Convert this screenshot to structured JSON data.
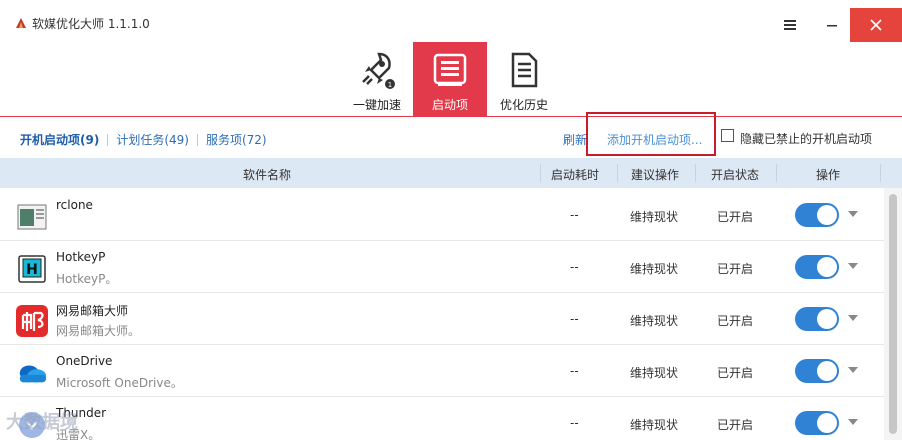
{
  "app": {
    "title": "软媒优化大师 1.1.1.0"
  },
  "window": {
    "menu_icon": "hamburger-icon",
    "min_icon": "minimize-icon",
    "close_icon": "close-icon"
  },
  "nav": [
    {
      "label": "一键加速",
      "icon": "rocket-icon",
      "active": false
    },
    {
      "label": "启动项",
      "icon": "startup-list-icon",
      "active": true
    },
    {
      "label": "优化历史",
      "icon": "document-icon",
      "active": false
    }
  ],
  "subtabs": [
    {
      "label": "开机启动项(9)",
      "active": true
    },
    {
      "label": "计划任务(49)",
      "active": false
    },
    {
      "label": "服务项(72)",
      "active": false
    }
  ],
  "actions": {
    "refresh": "刷新",
    "add_startup": "添加开机启动项...",
    "hide_disabled": "隐藏已禁止的开机启动项"
  },
  "columns": {
    "name": "软件名称",
    "time": "启动耗时",
    "advice": "建议操作",
    "state": "开启状态",
    "action": "操作"
  },
  "rows": [
    {
      "name": "rclone",
      "desc": "",
      "time": "--",
      "advice": "维持现状",
      "state": "已开启",
      "enabled": true,
      "icon": "rclone-app-icon"
    },
    {
      "name": "HotkeyP",
      "desc": "HotkeyP。",
      "time": "--",
      "advice": "维持现状",
      "state": "已开启",
      "enabled": true,
      "icon": "hotkeyp-app-icon"
    },
    {
      "name": "网易邮箱大师",
      "desc": "网易邮箱大师。",
      "time": "--",
      "advice": "维持现状",
      "state": "已开启",
      "enabled": true,
      "icon": "netease-mail-icon"
    },
    {
      "name": "OneDrive",
      "desc": "Microsoft OneDrive。",
      "time": "--",
      "advice": "维持现状",
      "state": "已开启",
      "enabled": true,
      "icon": "onedrive-cloud-icon"
    },
    {
      "name": "Thunder",
      "desc": "迅雷X。",
      "time": "--",
      "advice": "维持现状",
      "state": "已开启",
      "enabled": true,
      "icon": "thunder-app-icon"
    }
  ],
  "watermark": "大数据境",
  "colors": {
    "accent": "#e23a4a",
    "link": "#2d6db5",
    "toggle_on": "#2f82d4",
    "header_bg": "#dde8f5",
    "close_bg": "#e5443c"
  }
}
